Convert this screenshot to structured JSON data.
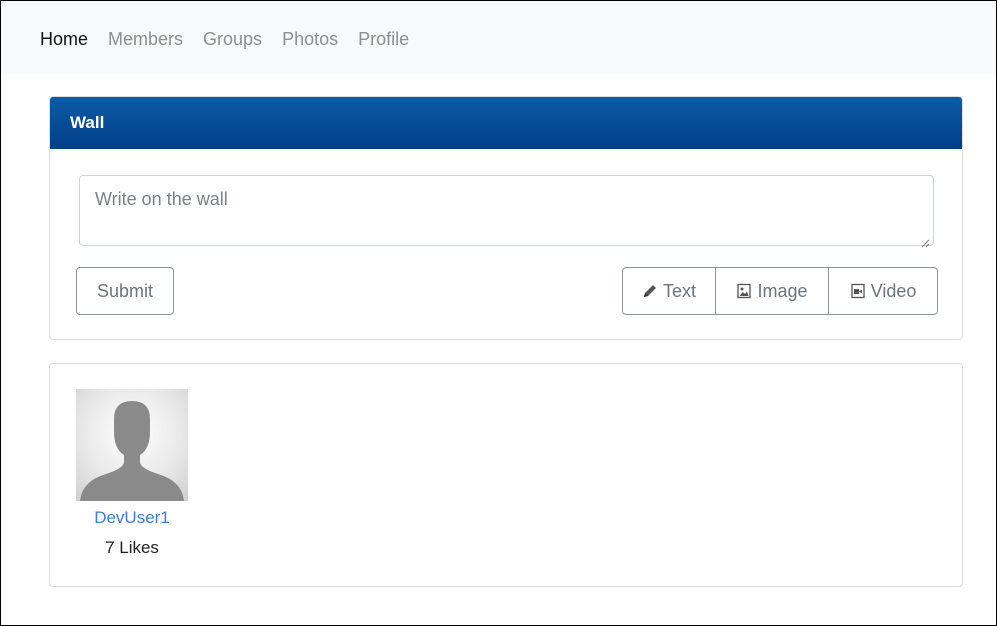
{
  "nav": {
    "items": [
      {
        "label": "Home",
        "active": true
      },
      {
        "label": "Members",
        "active": false
      },
      {
        "label": "Groups",
        "active": false
      },
      {
        "label": "Photos",
        "active": false
      },
      {
        "label": "Profile",
        "active": false
      }
    ]
  },
  "wall": {
    "title": "Wall",
    "input_placeholder": "Write on the wall",
    "submit_label": "Submit",
    "buttons": {
      "text": {
        "label": "Text",
        "icon": "pencil-icon"
      },
      "image": {
        "label": "Image",
        "icon": "image-icon"
      },
      "video": {
        "label": "Video",
        "icon": "video-icon"
      }
    }
  },
  "post": {
    "username": "DevUser1",
    "likes": "7 Likes",
    "avatar_icon": "default-avatar-icon"
  },
  "colors": {
    "header_top": "#0d5ba6",
    "header_bottom": "#003f87",
    "link": "#3a7fd6",
    "nav_bg": "#f8f9fa"
  }
}
